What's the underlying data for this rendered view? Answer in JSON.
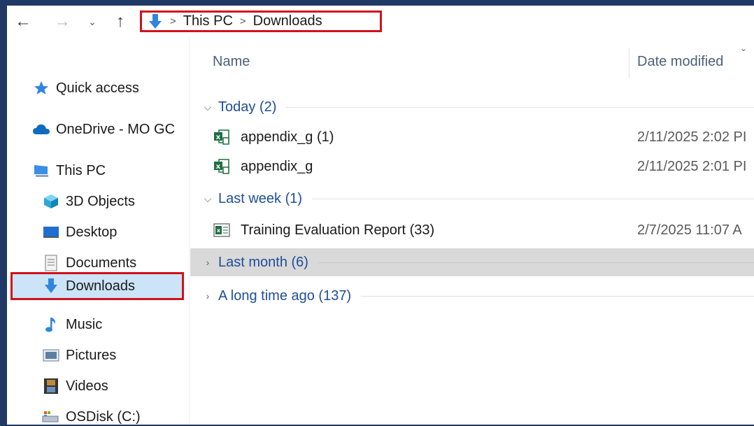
{
  "nav_buttons": {
    "back": "←",
    "forward": "→",
    "recent": "⌄",
    "up": "↑"
  },
  "breadcrumb": {
    "icon": "downloads-arrow-icon",
    "separator": ">",
    "items": [
      "This PC",
      "Downloads"
    ]
  },
  "sidebar": {
    "items": [
      {
        "label": "Quick access",
        "icon": "star-icon"
      },
      {
        "label": "OneDrive - MO GC",
        "icon": "cloud-icon"
      },
      {
        "label": "This PC",
        "icon": "computer-icon"
      },
      {
        "label": "3D Objects",
        "icon": "cube-icon"
      },
      {
        "label": "Desktop",
        "icon": "desktop-icon"
      },
      {
        "label": "Documents",
        "icon": "document-icon"
      },
      {
        "label": "Downloads",
        "icon": "downloads-arrow-icon",
        "selected": true
      },
      {
        "label": "Music",
        "icon": "music-note-icon"
      },
      {
        "label": "Pictures",
        "icon": "pictures-icon"
      },
      {
        "label": "Videos",
        "icon": "film-icon"
      },
      {
        "label": "OSDisk (C:)",
        "icon": "drive-icon"
      }
    ]
  },
  "columns": {
    "name": "Name",
    "date_modified": "Date modified",
    "sort_indicator": "⌄"
  },
  "groups": [
    {
      "title": "Today (2)",
      "expanded": true,
      "files": [
        {
          "name": "appendix_g (1)",
          "date": "2/11/2025 2:02 PI",
          "icon": "excel-csv-icon"
        },
        {
          "name": "appendix_g",
          "date": "2/11/2025 2:01 PI",
          "icon": "excel-csv-icon"
        }
      ]
    },
    {
      "title": "Last week (1)",
      "expanded": true,
      "files": [
        {
          "name": "Training Evaluation Report (33)",
          "date": "2/7/2025 11:07 A",
          "icon": "excel-workbook-icon"
        }
      ]
    },
    {
      "title": "Last month (6)",
      "expanded": false,
      "hovered": true,
      "files": []
    },
    {
      "title": "A long time ago (137)",
      "expanded": false,
      "files": []
    }
  ],
  "colors": {
    "accent_red": "#d3101a",
    "link_blue": "#1e4e96",
    "frame_border": "#1f3864"
  }
}
